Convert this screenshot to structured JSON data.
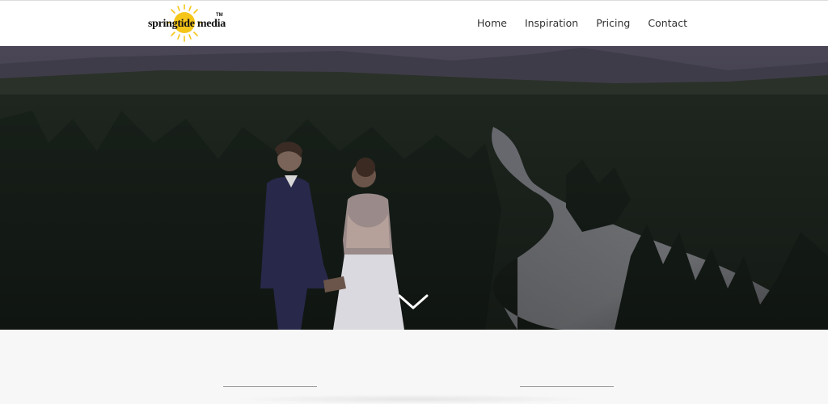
{
  "brand": {
    "name": "springtide media",
    "tm": "TM",
    "sun_color": "#f5c518"
  },
  "nav": {
    "items": [
      {
        "label": "Home"
      },
      {
        "label": "Inspiration"
      },
      {
        "label": "Pricing"
      },
      {
        "label": "Contact"
      }
    ]
  },
  "hero": {
    "image": "wedding couple overlooking forest river at dusk",
    "scroll_icon": "chevron-down-icon"
  },
  "colors": {
    "header_bg": "#ffffff",
    "page_bg": "#f7f7f7",
    "nav_text": "#333333"
  }
}
